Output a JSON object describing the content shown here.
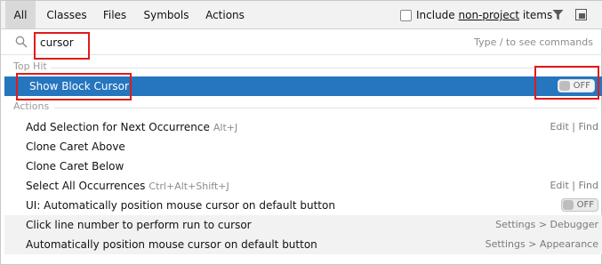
{
  "tabs": [
    {
      "label": "All",
      "active": true
    },
    {
      "label": "Classes"
    },
    {
      "label": "Files"
    },
    {
      "label": "Symbols"
    },
    {
      "label": "Actions"
    }
  ],
  "include": {
    "before": "Include ",
    "underlined": "non-project",
    "after": " items",
    "checked": false
  },
  "search": {
    "value": "cursor",
    "hint": "Type / to see commands"
  },
  "sections": {
    "top_hit": "Top Hit",
    "actions": "Actions"
  },
  "top_hit": {
    "label": "Show Block Cursor",
    "toggle": "OFF"
  },
  "actions": [
    {
      "label": "Add Selection for Next Occurrence",
      "shortcut": "Alt+J",
      "right": "Edit | Find"
    },
    {
      "label": "Clone Caret Above"
    },
    {
      "label": "Clone Caret Below"
    },
    {
      "label": "Select All Occurrences",
      "shortcut": "Ctrl+Alt+Shift+J",
      "right": "Edit | Find"
    },
    {
      "label": "UI: Automatically position mouse cursor on default button",
      "toggle": "OFF"
    },
    {
      "label": "Click line number to perform run to cursor",
      "right": "Settings > Debugger"
    },
    {
      "label": "Automatically position mouse cursor on default button",
      "right": "Settings > Appearance"
    }
  ],
  "colors": {
    "selection": "#2675bf",
    "annotation": "#e01b1b"
  },
  "icons": {
    "search": "search-icon",
    "filter": "filter-icon",
    "pin": "pin-icon"
  }
}
